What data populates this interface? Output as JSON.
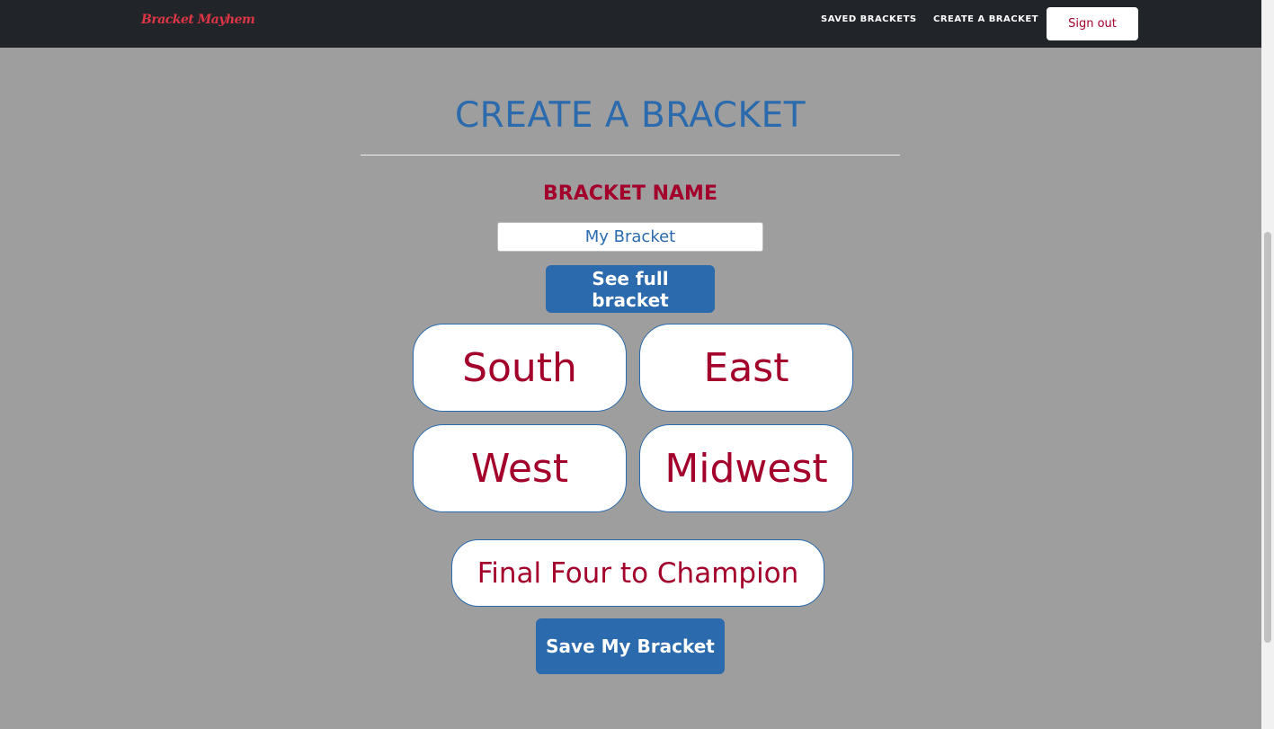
{
  "navbar": {
    "brand": "Bracket Mayhem",
    "links": [
      {
        "label": "SAVED BRACKETS"
      },
      {
        "label": "CREATE A BRACKET"
      }
    ],
    "signout_label": "Sign out"
  },
  "main": {
    "title": "CREATE A BRACKET",
    "name_label": "BRACKET NAME",
    "name_input": {
      "value": "My Bracket"
    },
    "see_full_label": "See full bracket",
    "regions": [
      {
        "label": "South"
      },
      {
        "label": "East"
      },
      {
        "label": "West"
      },
      {
        "label": "Midwest"
      }
    ],
    "final_four_label": "Final Four to Champion",
    "save_label": "Save My Bracket"
  },
  "colors": {
    "navbar_bg": "#212529",
    "page_bg": "#9e9e9e",
    "accent_blue": "#2a6aad",
    "accent_red": "#a3002b",
    "brand_red": "#dc3545"
  }
}
